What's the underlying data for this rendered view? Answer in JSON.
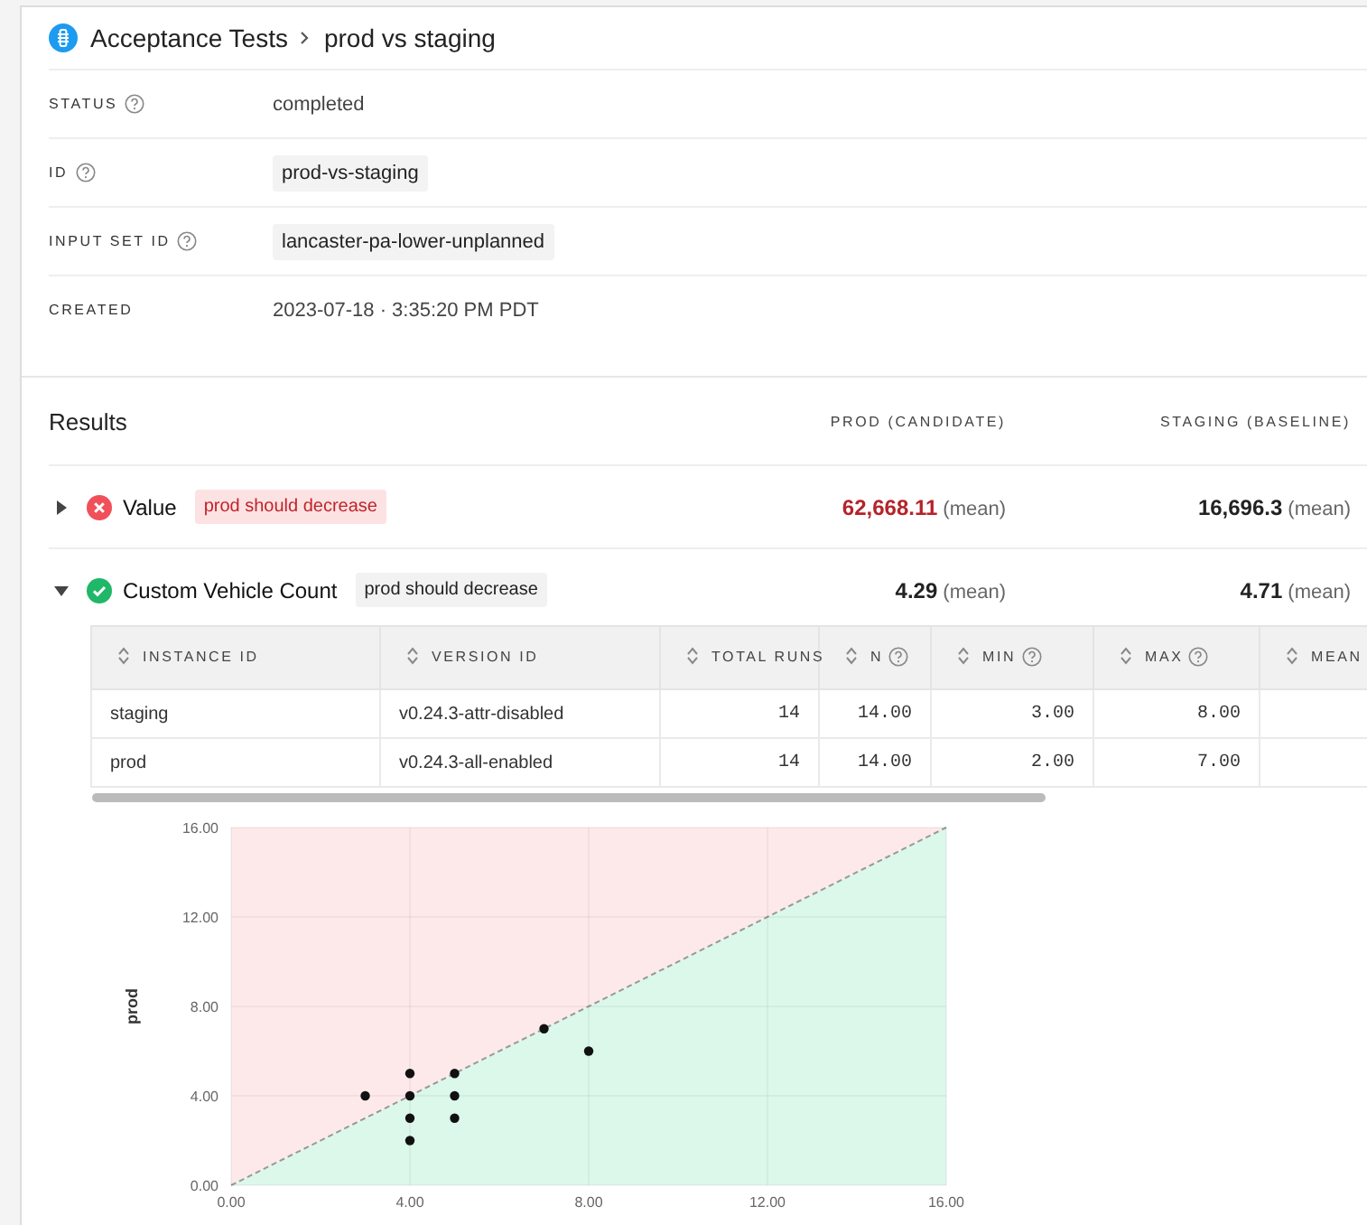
{
  "breadcrumb": {
    "parent": "Acceptance Tests",
    "current": "prod vs staging"
  },
  "details": [
    {
      "label": "STATUS",
      "help": true,
      "kind": "plain",
      "value": "completed"
    },
    {
      "label": "ID",
      "help": true,
      "kind": "code",
      "value": "prod-vs-staging"
    },
    {
      "label": "INPUT SET ID",
      "help": true,
      "kind": "code",
      "value": "lancaster-pa-lower-unplanned"
    },
    {
      "label": "CREATED",
      "help": false,
      "kind": "plain",
      "value": "2023-07-18 · 3:35:20 PM PDT"
    }
  ],
  "results": {
    "title": "Results",
    "columns": [
      "PROD (CANDIDATE)",
      "STAGING (BASELINE)"
    ],
    "metrics": [
      {
        "name": "Value",
        "expanded": false,
        "passed": false,
        "expectation": "prod should decrease",
        "candidate": "62,668.11",
        "candidate_unit": "(mean)",
        "baseline": "16,696.3",
        "baseline_unit": "(mean)"
      },
      {
        "name": "Custom Vehicle Count",
        "expanded": true,
        "passed": true,
        "expectation": "prod should decrease",
        "candidate": "4.29",
        "candidate_unit": "(mean)",
        "baseline": "4.71",
        "baseline_unit": "(mean)",
        "table": {
          "columns": [
            {
              "label": "INSTANCE ID",
              "help": false
            },
            {
              "label": "VERSION ID",
              "help": false
            },
            {
              "label": "TOTAL RUNS",
              "help": false
            },
            {
              "label": "N",
              "help": true
            },
            {
              "label": "MIN",
              "help": true
            },
            {
              "label": "MAX",
              "help": true
            },
            {
              "label": "MEAN",
              "help": false
            }
          ],
          "rows": [
            [
              "staging",
              "v0.24.3-attr-disabled",
              "14",
              "14.00",
              "3.00",
              "8.00"
            ],
            [
              "prod",
              "v0.24.3-all-enabled",
              "14",
              "14.00",
              "2.00",
              "7.00"
            ]
          ]
        },
        "chart_data": {
          "type": "scatter",
          "ylabel": "prod",
          "x": [
            3,
            4,
            4,
            4,
            4,
            5,
            5,
            5,
            7,
            8
          ],
          "series": [
            {
              "color": "#111111",
              "values": [
                4,
                5,
                4,
                3,
                2,
                5,
                4,
                3,
                7,
                6
              ]
            }
          ],
          "xlim": [
            0,
            16
          ],
          "ylim": [
            0,
            16
          ],
          "grid": true,
          "xticks": [
            {
              "value": 0,
              "label": "0.00"
            },
            {
              "value": 4,
              "label": "4.00"
            },
            {
              "value": 8,
              "label": "8.00"
            },
            {
              "value": 12,
              "label": "12.00"
            },
            {
              "value": 16,
              "label": "16.00"
            }
          ],
          "yticks": [
            {
              "value": 0,
              "label": "0.00"
            },
            {
              "value": 4,
              "label": "4.00"
            },
            {
              "value": 8,
              "label": "8.00"
            },
            {
              "value": 12,
              "label": "12.00"
            },
            {
              "value": 16,
              "label": "16.00"
            }
          ]
        }
      }
    ]
  }
}
